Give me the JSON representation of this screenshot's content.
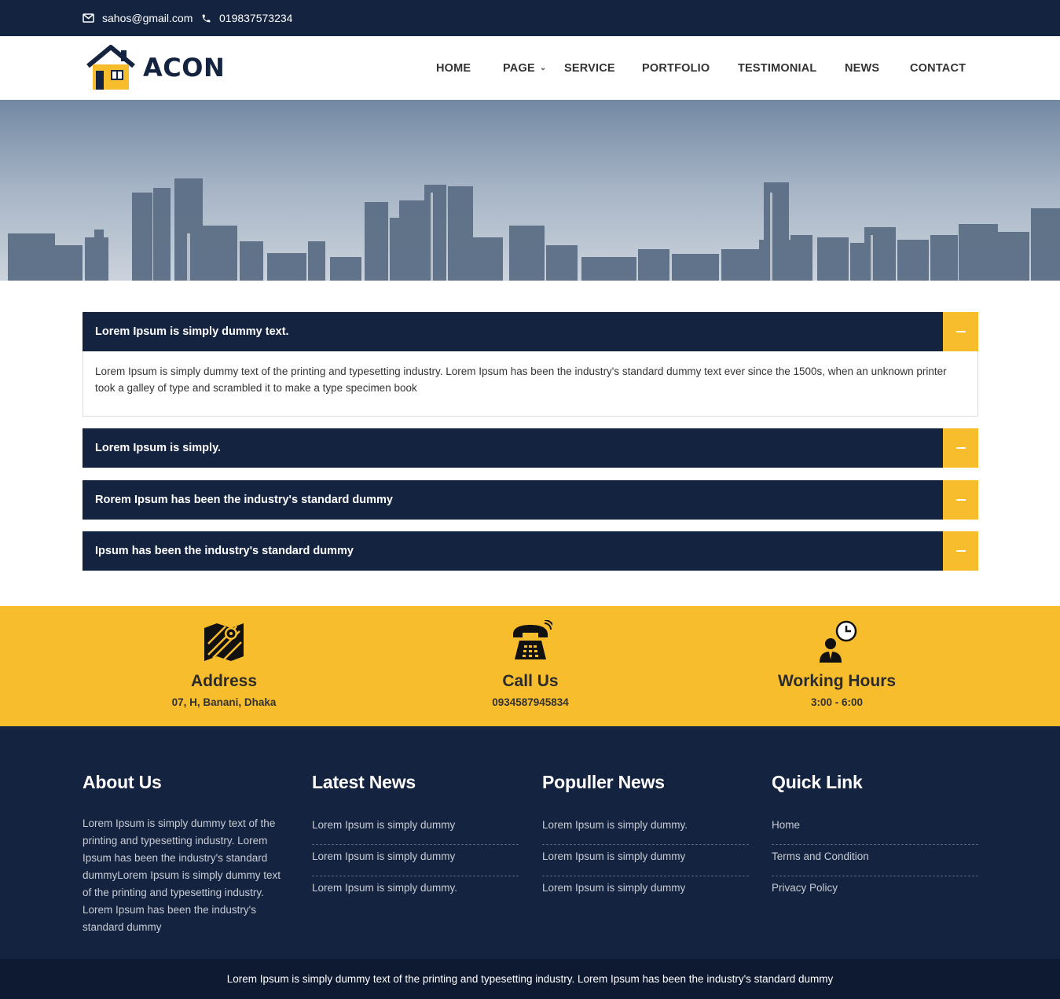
{
  "topbar": {
    "email": "sahos@gmail.com",
    "phone": "019837573234"
  },
  "brand": {
    "name": "ACON"
  },
  "nav": {
    "items": [
      "HOME",
      "PAGE",
      "SERVICE",
      "PORTFOLIO",
      "TESTIMONIAL",
      "NEWS",
      "CONTACT"
    ]
  },
  "accordion": [
    {
      "title": "Lorem Ipsum is simply dummy text.",
      "body": "Lorem Ipsum is simply dummy text of the printing and typesetting industry. Lorem Ipsum has been the industry's standard dummy text ever since the 1500s, when an unknown printer took a galley of type and scrambled it to make a type specimen book",
      "expanded": true
    },
    {
      "title": "Lorem Ipsum is simply.",
      "expanded": false
    },
    {
      "title": "Rorem Ipsum has been the industry's standard dummy",
      "expanded": false
    },
    {
      "title": "Ipsum has been the industry's standard dummy",
      "expanded": false
    }
  ],
  "contact": [
    {
      "icon": "map-icon",
      "title": "Address",
      "text": "07, H, Banani, Dhaka"
    },
    {
      "icon": "telephone-icon",
      "title": "Call Us",
      "text": "0934587945834"
    },
    {
      "icon": "clock-person-icon",
      "title": "Working Hours",
      "text": "3:00 - 6:00"
    }
  ],
  "footer": {
    "about": {
      "title": "About Us",
      "text": "Lorem Ipsum is simply dummy text of the printing and typesetting industry. Lorem Ipsum has been the industry's standard dummyLorem Ipsum is simply dummy text of the printing and typesetting industry. Lorem Ipsum has been the industry's standard dummy"
    },
    "latest_news": {
      "title": "Latest News",
      "items": [
        "Lorem Ipsum is simply dummy",
        "Lorem Ipsum is simply dummy",
        "Lorem Ipsum is simply dummy."
      ]
    },
    "popular_news": {
      "title": "Populler News",
      "items": [
        "Lorem Ipsum is simply dummy.",
        "Lorem Ipsum is simply dummy",
        "Lorem Ipsum is simply dummy"
      ]
    },
    "quick_link": {
      "title": "Quick Link",
      "items": [
        "Home",
        "Terms and Condition",
        "Privacy Policy"
      ]
    }
  },
  "copyright": "Lorem Ipsum is simply dummy text of the printing and typesetting industry. Lorem Ipsum has been the industry's standard dummy",
  "colors": {
    "navy": "#142340",
    "accent": "#f8bd2c"
  }
}
